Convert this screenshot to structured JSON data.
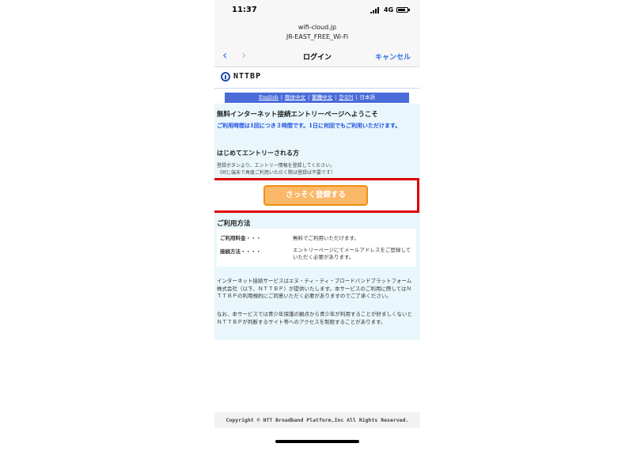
{
  "status_bar": {
    "time": "11:37",
    "network": "4G"
  },
  "browser": {
    "url": "wifi-cloud.jp",
    "ssid": "JR-EAST_FREE_Wi-Fi"
  },
  "nav": {
    "back_icon": "‹",
    "forward_icon": "›",
    "title": "ログイン",
    "cancel": "キャンセル"
  },
  "logo": {
    "text": "NTTBP"
  },
  "languages": {
    "items": [
      "English",
      "簡体中文",
      "繁體中文",
      "한국어",
      "日本語"
    ],
    "separator": "|"
  },
  "welcome": "無料インターネット接続エントリーページへようこそ",
  "notice": "ご利用時間は1回につき３時間です。1日に何回でもご利用いただけます。",
  "first_time": {
    "heading": "はじめてエントリーされる方",
    "note_line1": "登録ボタンより、エントリー情報を登録してください。",
    "note_line2": "（同じ端末で再度ご利用いただく際は登録は不要です）"
  },
  "register_button": "さっそく登録する",
  "usage": {
    "heading": "ご利用方法",
    "fee_label": "ご利用料金・・・",
    "fee_value": "無料でご利用いただけます。",
    "method_label": "接続方法・・・・",
    "method_value": "エントリーページにてメールアドレスをご登録していただく必要があります。"
  },
  "info": {
    "paragraph1": "インターネット接続サービスはエヌ・ティ・ティ・ブロードバンドプラットフォーム株式会社（以下、ＮＴＴＢＰ）が提供いたします。本サービスのご利用に際してはＮＴＴＢＰの利用規約にご同意いただく必要がありますのでご了承ください。",
    "paragraph2": "なお、本サービスでは青少年保護の観点から青少年が利用することが好ましくないとＮＴＴＢＰが判断するサイト等へのアクセスを制限することがあります。"
  },
  "footer": "Copyright © NTT Broadband Platform,Inc All Rights Reserved."
}
